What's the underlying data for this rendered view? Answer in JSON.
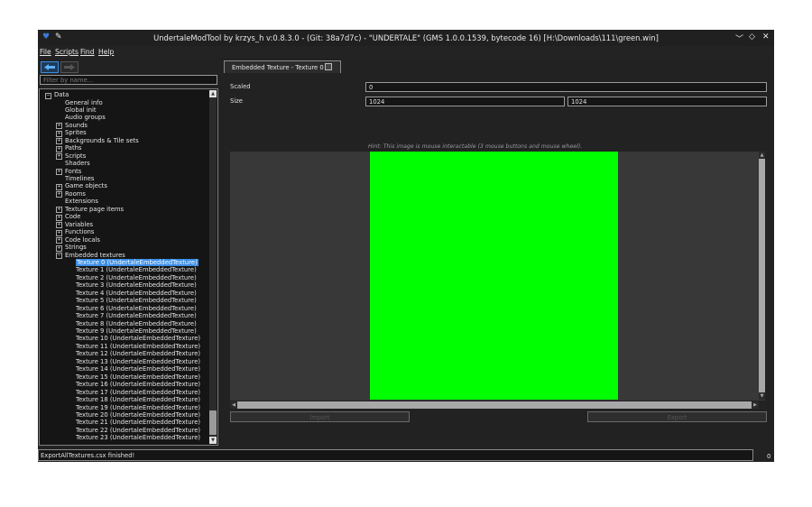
{
  "window": {
    "title": "UndertaleModTool by krzys_h v:0.8.3.0 - (Git: 38a7d7c) - \"UNDERTALE\" (GMS 1.0.0.1539, bytecode 16) [H:\\Downloads\\111\\green.win]",
    "controls": [
      "﹀",
      "◇",
      "✕"
    ]
  },
  "menu": [
    "File",
    "Scripts",
    "Find",
    "Help"
  ],
  "filter": {
    "placeholder": "Filter by name..."
  },
  "tree": {
    "root": "Data",
    "items": [
      {
        "label": "General info",
        "expandable": false
      },
      {
        "label": "Global init",
        "expandable": false
      },
      {
        "label": "Audio groups",
        "expandable": false
      },
      {
        "label": "Sounds",
        "expandable": true
      },
      {
        "label": "Sprites",
        "expandable": true
      },
      {
        "label": "Backgrounds & Tile sets",
        "expandable": true
      },
      {
        "label": "Paths",
        "expandable": true
      },
      {
        "label": "Scripts",
        "expandable": true
      },
      {
        "label": "Shaders",
        "expandable": false
      },
      {
        "label": "Fonts",
        "expandable": true
      },
      {
        "label": "Timelines",
        "expandable": false
      },
      {
        "label": "Game objects",
        "expandable": true
      },
      {
        "label": "Rooms",
        "expandable": true
      },
      {
        "label": "Extensions",
        "expandable": false
      },
      {
        "label": "Texture page items",
        "expandable": true
      },
      {
        "label": "Code",
        "expandable": true
      },
      {
        "label": "Variables",
        "expandable": true
      },
      {
        "label": "Functions",
        "expandable": true
      },
      {
        "label": "Code locals",
        "expandable": true
      },
      {
        "label": "Strings",
        "expandable": true
      },
      {
        "label": "Embedded textures",
        "expandable": true,
        "expanded": true
      }
    ],
    "textures": [
      "Texture 0 (UndertaleEmbeddedTexture)",
      "Texture 1 (UndertaleEmbeddedTexture)",
      "Texture 2 (UndertaleEmbeddedTexture)",
      "Texture 3 (UndertaleEmbeddedTexture)",
      "Texture 4 (UndertaleEmbeddedTexture)",
      "Texture 5 (UndertaleEmbeddedTexture)",
      "Texture 6 (UndertaleEmbeddedTexture)",
      "Texture 7 (UndertaleEmbeddedTexture)",
      "Texture 8 (UndertaleEmbeddedTexture)",
      "Texture 9 (UndertaleEmbeddedTexture)",
      "Texture 10 (UndertaleEmbeddedTexture)",
      "Texture 11 (UndertaleEmbeddedTexture)",
      "Texture 12 (UndertaleEmbeddedTexture)",
      "Texture 13 (UndertaleEmbeddedTexture)",
      "Texture 14 (UndertaleEmbeddedTexture)",
      "Texture 15 (UndertaleEmbeddedTexture)",
      "Texture 16 (UndertaleEmbeddedTexture)",
      "Texture 17 (UndertaleEmbeddedTexture)",
      "Texture 18 (UndertaleEmbeddedTexture)",
      "Texture 19 (UndertaleEmbeddedTexture)",
      "Texture 20 (UndertaleEmbeddedTexture)",
      "Texture 21 (UndertaleEmbeddedTexture)",
      "Texture 22 (UndertaleEmbeddedTexture)",
      "Texture 23 (UndertaleEmbeddedTexture)"
    ],
    "selected": "Texture 0 (UndertaleEmbeddedTexture)"
  },
  "tab": {
    "label": "Embedded Texture - Texture 0"
  },
  "editor": {
    "scaled_label": "Scaled",
    "scaled_value": "0",
    "size_label": "Size",
    "width": "1024",
    "height": "1024",
    "hint": "Hint: This image is mouse interactable (3 mouse buttons and mouse wheel).",
    "texture_color": "#00ff00",
    "import_label": "Import",
    "export_label": "Export"
  },
  "status": {
    "text": "ExportAllTextures.csx finished!",
    "count": "0"
  }
}
